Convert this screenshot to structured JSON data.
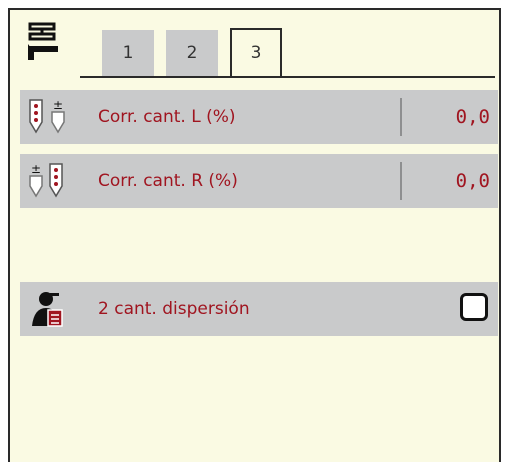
{
  "tabs": [
    {
      "label": "1",
      "active": false
    },
    {
      "label": "2",
      "active": false
    },
    {
      "label": "3",
      "active": true
    }
  ],
  "rows": [
    {
      "icon": "corr-left-icon",
      "label": "Corr. cant. L (%)",
      "value": "0,0"
    },
    {
      "icon": "corr-right-icon",
      "label": "Corr. cant. R (%)",
      "value": "0,0"
    }
  ],
  "option": {
    "icon": "operator-doc-icon",
    "label": "2 cant. dispersión",
    "checked": false
  },
  "colors": {
    "background": "#fafae3",
    "row": "#c9cacb",
    "text_accent": "#a01520"
  }
}
